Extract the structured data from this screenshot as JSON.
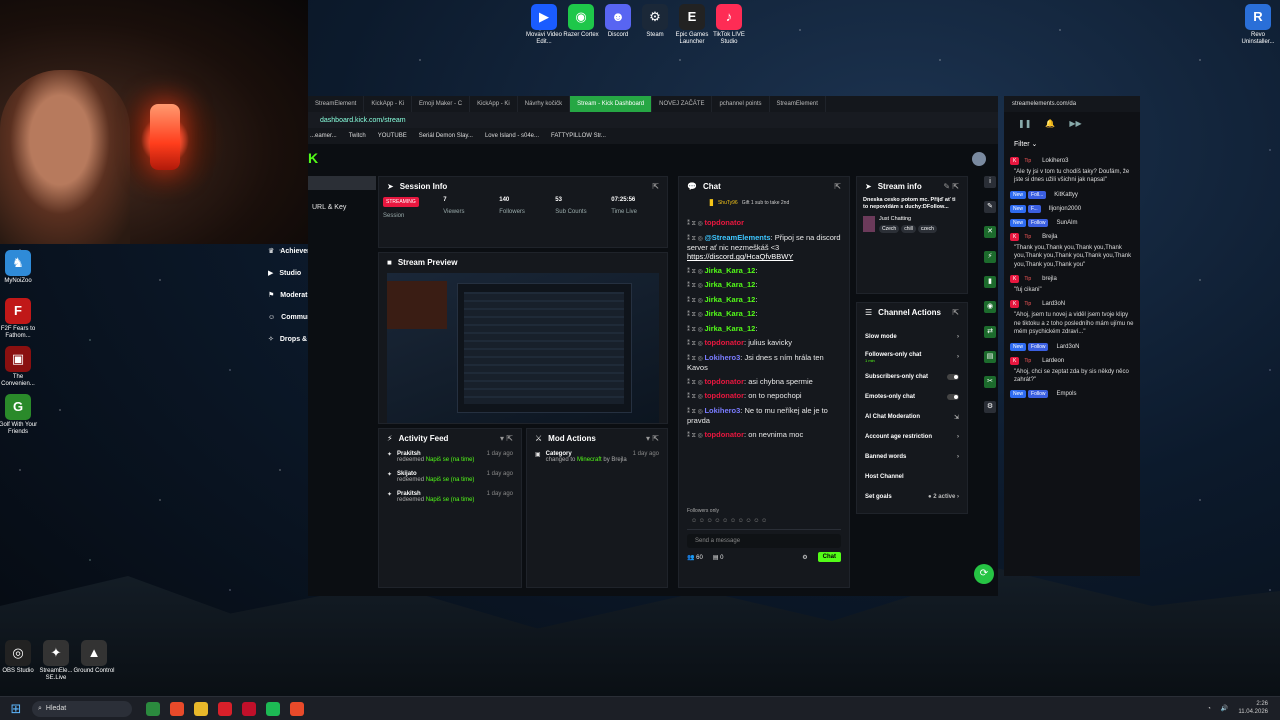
{
  "desktop": {
    "top_icons": [
      {
        "label": "Movavi Video Edit...",
        "color": "#1a5cff",
        "glyph": "▶"
      },
      {
        "label": "Razer Cortex",
        "color": "#1ec74a",
        "glyph": "◉"
      },
      {
        "label": "Discord",
        "color": "#5865f2",
        "glyph": "☻"
      },
      {
        "label": "Steam",
        "color": "#1b2838",
        "glyph": "⚙"
      },
      {
        "label": "Epic Games Launcher",
        "color": "#222",
        "glyph": "E"
      },
      {
        "label": "TikTok LIVE Studio",
        "color": "#fe2c55",
        "glyph": "♪"
      }
    ],
    "left_icons": [
      {
        "label": "MyNoiZoo",
        "color": "#2f8bd8",
        "glyph": "♞"
      },
      {
        "label": "F2F Fears to Fathom...",
        "color": "#c01818",
        "glyph": "F"
      },
      {
        "label": "The Convenien...",
        "color": "#8a1010",
        "glyph": "▣"
      },
      {
        "label": "Golf With Your Friends",
        "color": "#2a8a2a",
        "glyph": "G"
      }
    ],
    "bottom_icons": [
      {
        "label": "OBS Studio",
        "color": "#222",
        "glyph": "◎"
      },
      {
        "label": "StreamEle... SE.Live",
        "color": "#333",
        "glyph": "✦"
      },
      {
        "label": "Ground Control",
        "color": "#333",
        "glyph": "▲"
      }
    ],
    "right_icon": {
      "label": "Revo Uninstaller...",
      "color": "#2a6fd8",
      "glyph": "R"
    }
  },
  "taskbar": {
    "search_placeholder": "Hledat",
    "time": "2:26",
    "date": "11.04.2026"
  },
  "browser": {
    "tabs": [
      "StreamElement",
      "KickApp - Ki",
      "Emoji Maker - C",
      "KickApp - Ki",
      "Návrhy kočičk",
      "Stream - Kick Dashboard",
      "NOVEJ ZAČÁTE",
      "pchannel points",
      "StreamElement"
    ],
    "active_tab": 5,
    "url": "dashboard.kick.com/stream",
    "bookmarks": [
      "...eamer...",
      "Twitch",
      "YOUTUBE",
      "Seriál Demon Slay...",
      "Love Island - s04e...",
      "FATTYPILLOW Str..."
    ]
  },
  "kick": {
    "sidebar": {
      "url_key": "URL & Key"
    },
    "nav": [
      {
        "label": "Achievements",
        "icon": "trophy-icon",
        "glyph": "♛",
        "chevron": false
      },
      {
        "label": "Studio",
        "icon": "studio-icon",
        "glyph": "▶",
        "chevron": true
      },
      {
        "label": "Moderation",
        "icon": "shield-icon",
        "glyph": "⚑",
        "chevron": false
      },
      {
        "label": "Community",
        "icon": "community-icon",
        "glyph": "☺",
        "chevron": true
      },
      {
        "label": "Drops & rewards",
        "icon": "gift-icon",
        "glyph": "✧",
        "chevron": false
      }
    ],
    "session": {
      "title": "Session Info",
      "status": "STREAMING",
      "stats": [
        {
          "value": "7",
          "label": "Viewers"
        },
        {
          "value": "140",
          "label": "Followers"
        },
        {
          "value": "53",
          "label": "Sub Counts"
        },
        {
          "value": "07:25:56",
          "label": "Time Live"
        }
      ],
      "session_label": "Session"
    },
    "preview_title": "Stream Preview",
    "activity": {
      "title": "Activity Feed",
      "items": [
        {
          "name": "Prakitsh",
          "action": "redeemed",
          "reward": "Napiš se (na time)",
          "ago": "1 day ago"
        },
        {
          "name": "Skijato",
          "action": "redeemed",
          "reward": "Napiš se (na time)",
          "ago": "1 day ago"
        },
        {
          "name": "Prakitsh",
          "action": "redeemed",
          "reward": "Napiš se (na time)",
          "ago": "1 day ago"
        }
      ]
    },
    "mod_actions": {
      "title": "Mod Actions",
      "items": [
        {
          "name": "Category",
          "action": "changed to",
          "value": "Minecraft",
          "by": "by Brejla",
          "ago": "1 day ago"
        }
      ]
    },
    "chat": {
      "title": "Chat",
      "pinned_user": "ShuTy96",
      "pinned_text": "Gift 1 sub to take 2nd",
      "lines": [
        {
          "user": "topdonator",
          "cls": "u-red",
          "text": ""
        },
        {
          "user": "@StreamElements",
          "cls": "u-cya",
          "text": ": Připoj se na discord server ať nic nezmeškáš <3 ",
          "link": "https://discord.gg/HcaQfvBBWY"
        },
        {
          "user": "Jirka_Kara_12",
          "cls": "u-grn",
          "text": ":"
        },
        {
          "user": "Jirka_Kara_12",
          "cls": "u-grn",
          "text": ":"
        },
        {
          "user": "Jirka_Kara_12",
          "cls": "u-grn",
          "text": ":"
        },
        {
          "user": "Jirka_Kara_12",
          "cls": "u-grn",
          "text": ":"
        },
        {
          "user": "Jirka_Kara_12",
          "cls": "u-grn",
          "text": ":"
        },
        {
          "user": "topdonator",
          "cls": "u-red",
          "text": ": julius kavicky"
        },
        {
          "user": "Lokihero3",
          "cls": "u-blu",
          "text": ": Jsi dnes s ním hrála ten Kavos"
        },
        {
          "user": "topdonator",
          "cls": "u-red",
          "text": ": asi chybna spermie"
        },
        {
          "user": "topdonator",
          "cls": "u-red",
          "text": ": on to nepochopi"
        },
        {
          "user": "Lokihero3",
          "cls": "u-blu",
          "text": ": Ne to mu neříkej ale je to pravda"
        },
        {
          "user": "topdonator",
          "cls": "u-red",
          "text": ": on nevnima moc"
        }
      ],
      "followers_only": "Followers only",
      "placeholder": "Send a message",
      "send": "Chat",
      "count": "60",
      "count2": "0"
    },
    "stream_info": {
      "title": "Stream info",
      "desc": "Dneska cesko potom mc. Přijď ať ti to nepovídám s duchy:DFollow...",
      "category": "Just Chatting",
      "tags": [
        "Czech",
        "chill",
        "czech"
      ]
    },
    "channel_actions": {
      "title": "Channel Actions",
      "rows": [
        {
          "label": "Slow mode",
          "sub": "",
          "right": "›"
        },
        {
          "label": "Followers-only chat",
          "sub": "1 min",
          "right": "›"
        },
        {
          "label": "Subscribers-only chat",
          "sub": "",
          "right": "toggle"
        },
        {
          "label": "Emotes-only chat",
          "sub": "",
          "right": "toggle"
        },
        {
          "label": "AI Chat Moderation",
          "sub": "",
          "right": "⇲"
        },
        {
          "label": "Account age restriction",
          "sub": "",
          "right": "›"
        },
        {
          "label": "Banned words",
          "sub": "",
          "right": "›"
        },
        {
          "label": "Host Channel",
          "sub": "",
          "right": ""
        },
        {
          "label": "Set goals",
          "sub": "",
          "right": "● 2 active ›"
        }
      ]
    }
  },
  "se": {
    "url": "streamelements.com/da",
    "filter": "Filter",
    "events": [
      {
        "kind": "tip",
        "who": "Lokihero3",
        "msg": "\"Ale ty jsi v tom tu chodíš taky? Doufám, že jste si dnes užili všichni jak napsal\""
      },
      {
        "kind": "new",
        "label": "Foll...",
        "who": "KitKattyy",
        "msg": ""
      },
      {
        "kind": "new",
        "label": "F...",
        "who": "Iljonjon2000",
        "msg": ""
      },
      {
        "kind": "new",
        "label": "Follow",
        "who": "SunAlm",
        "msg": ""
      },
      {
        "kind": "tip",
        "who": "Brejla",
        "msg": "\"Thank you,Thank you,Thank you,Thank you,Thank you,Thank you,Thank you,Thank you,Thank you,Thank you\""
      },
      {
        "kind": "tip",
        "who": "brejla",
        "msg": "\"fuj cikani\""
      },
      {
        "kind": "tip",
        "who": "Lard3oN",
        "msg": "\"Ahoj, jsem tu novej a viděl jsem tvoje klipy ne tiktoku a z toho posledního mám ujímu ne mém psychickém zdraví...\""
      },
      {
        "kind": "new",
        "label": "Follow",
        "who": "Lard3oN",
        "msg": ""
      },
      {
        "kind": "tip",
        "who": "Lardeon",
        "msg": "\"Ahoj, chci se zeptat zda by sis někdy něco zahrát?\""
      },
      {
        "kind": "new",
        "label": "Follow",
        "who": "Empols",
        "msg": ""
      }
    ]
  }
}
